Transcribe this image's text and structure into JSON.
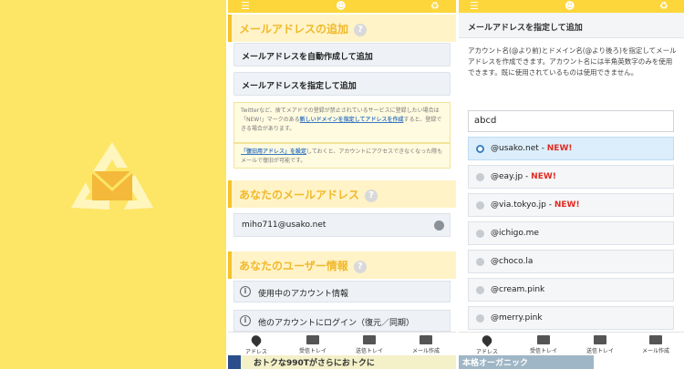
{
  "left_phone": {
    "section_add": "メールアドレスの追加",
    "btn_auto": "メールアドレスを自動作成して追加",
    "btn_specify": "メールアドレスを指定して追加",
    "note1_pre": "Twitterなど、捨てメアドでの登録が禁止されているサービスに登録したい場合は「NEW!」マークのある",
    "note1_link": "新しいドメインを指定してアドレスを作成",
    "note1_post": "すると、登録できる場合があります。",
    "note2_link": "「復旧用アドレス」を設定",
    "note2_post": "しておくと、アカウントにアクセスできなくなった際もメールで復旧が可能です。",
    "section_your_address": "あなたのメールアドレス",
    "address": "miho711@usako.net",
    "section_user_info": "あなたのユーザー情報",
    "btn_account_info": "使用中のアカウント情報",
    "btn_login_other": "他のアカウントにログイン（復元／同期）"
  },
  "tabs": [
    "アドレス",
    "受信トレイ",
    "送信トレイ",
    "メール作成"
  ],
  "ads": {
    "left_text": "おトクな990Tがさらにおトクに",
    "right_text": "本格オーガニック"
  },
  "right_phone": {
    "title": "メールアドレスを指定して追加",
    "desc": "アカウント名(@より前)とドメイン名(@より後ろ)を指定してメールアドレスを作成できます。アカウント名には半角英数字のみを使用できます。既に使用されているものは使用できません。",
    "input_value": "abcd",
    "domains": [
      {
        "name": "@usako.net",
        "sep": " - ",
        "new": "NEW!"
      },
      {
        "name": "@eay.jp",
        "sep": " - ",
        "new": "NEW!"
      },
      {
        "name": "@via.tokyo.jp",
        "sep": " - ",
        "new": "NEW!"
      },
      {
        "name": "@ichigo.me",
        "sep": "",
        "new": ""
      },
      {
        "name": "@choco.la",
        "sep": "",
        "new": ""
      },
      {
        "name": "@cream.pink",
        "sep": "",
        "new": ""
      },
      {
        "name": "@merry.pink",
        "sep": "",
        "new": ""
      }
    ]
  },
  "icons": {
    "brand": "mail-recycle-logo",
    "menu": "hamburger-icon",
    "center": "robot-icon",
    "refresh": "recycle-icon"
  },
  "colors": {
    "brand_yellow": "#fde566",
    "topbar": "#fcd63b",
    "section_text": "#f1b92b",
    "new_red": "#e02b20",
    "selected_blue": "#dceefb"
  }
}
